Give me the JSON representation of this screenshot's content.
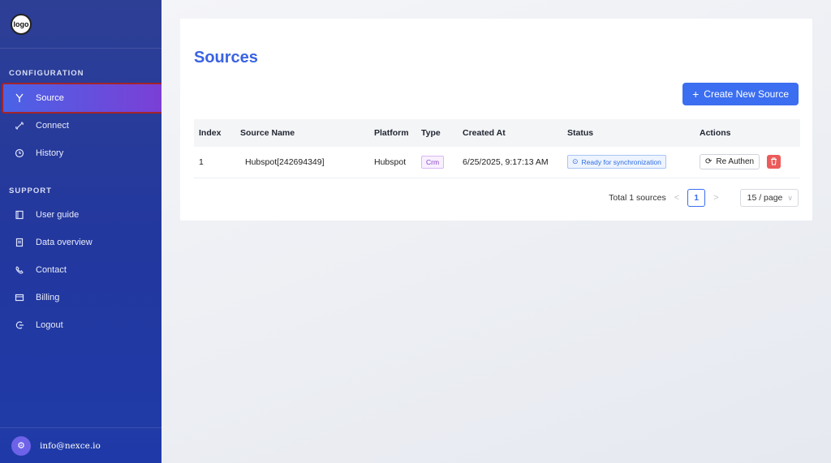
{
  "sidebar": {
    "logo_text": "logo",
    "sections": {
      "configuration": "CONFIGURATION",
      "support": "SUPPORT"
    },
    "items": [
      {
        "label": "Source",
        "icon": "fork-icon"
      },
      {
        "label": "Connect",
        "icon": "link-icon"
      },
      {
        "label": "History",
        "icon": "clock-icon"
      },
      {
        "label": "User guide",
        "icon": "book-icon"
      },
      {
        "label": "Data overview",
        "icon": "document-icon"
      },
      {
        "label": "Contact",
        "icon": "phone-icon"
      },
      {
        "label": "Billing",
        "icon": "card-icon"
      },
      {
        "label": "Logout",
        "icon": "logout-icon"
      }
    ],
    "user": {
      "email": "info@nexce.io"
    }
  },
  "main": {
    "title": "Sources",
    "create_button": "Create New Source",
    "table": {
      "headers": [
        "Index",
        "Source Name",
        "Platform",
        "Type",
        "Created At",
        "Status",
        "Actions"
      ],
      "rows": [
        {
          "index": "1",
          "source_name": "Hubspot[242694349]",
          "platform": "Hubspot",
          "type": "Crm",
          "created_at": "6/25/2025, 9:17:13 AM",
          "status": "Ready for synchronization",
          "action_label": "Re Authen"
        }
      ]
    },
    "pagination": {
      "total": "Total 1 sources",
      "current_page": "1",
      "page_size": "15 / page"
    }
  },
  "colors": {
    "accent": "#3b6ef0",
    "sidebar_bg": "#23389e",
    "danger": "#ec5b5b"
  }
}
